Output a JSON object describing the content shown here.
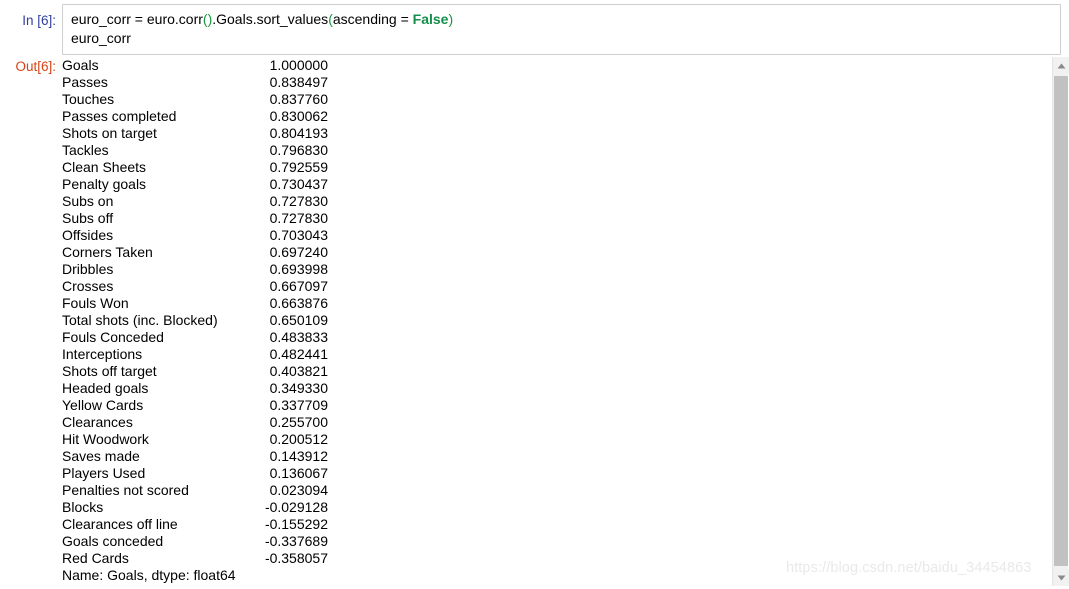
{
  "notebook": {
    "input": {
      "prompt": "In [6]:",
      "prompt_color": "#303F9F",
      "code_lines": [
        {
          "segments": [
            {
              "text": "euro_corr = euro.corr",
              "style": "plain"
            },
            {
              "text": "()",
              "style": "paren"
            },
            {
              "text": ".Goals.sort_values",
              "style": "plain"
            },
            {
              "text": "(",
              "style": "paren"
            },
            {
              "text": "ascending = ",
              "style": "plain"
            },
            {
              "text": "False",
              "style": "keyword"
            },
            {
              "text": ")",
              "style": "paren"
            }
          ],
          "plain_text": "euro_corr = euro.corr().Goals.sort_values(ascending = False)"
        },
        {
          "segments": [
            {
              "text": "euro_corr",
              "style": "plain"
            }
          ],
          "plain_text": "euro_corr"
        }
      ]
    },
    "output": {
      "prompt": "Out[6]:",
      "prompt_color": "#D84315",
      "series_name_line": "Name: Goals, dtype: float64",
      "rows": [
        {
          "label": "Goals",
          "value": "1.000000"
        },
        {
          "label": "Passes",
          "value": "0.838497"
        },
        {
          "label": "Touches",
          "value": "0.837760"
        },
        {
          "label": "Passes completed",
          "value": "0.830062"
        },
        {
          "label": "Shots on target",
          "value": "0.804193"
        },
        {
          "label": "Tackles",
          "value": "0.796830"
        },
        {
          "label": "Clean Sheets",
          "value": "0.792559"
        },
        {
          "label": "Penalty goals",
          "value": "0.730437"
        },
        {
          "label": "Subs on",
          "value": "0.727830"
        },
        {
          "label": "Subs off",
          "value": "0.727830"
        },
        {
          "label": "Offsides",
          "value": "0.703043"
        },
        {
          "label": "Corners Taken",
          "value": "0.697240"
        },
        {
          "label": "Dribbles",
          "value": "0.693998"
        },
        {
          "label": "Crosses",
          "value": "0.667097"
        },
        {
          "label": "Fouls Won",
          "value": "0.663876"
        },
        {
          "label": "Total shots (inc. Blocked)",
          "value": "0.650109"
        },
        {
          "label": "Fouls Conceded",
          "value": "0.483833"
        },
        {
          "label": "Interceptions",
          "value": "0.482441"
        },
        {
          "label": "Shots off target",
          "value": "0.403821"
        },
        {
          "label": "Headed goals",
          "value": "0.349330"
        },
        {
          "label": "Yellow Cards",
          "value": "0.337709"
        },
        {
          "label": "Clearances",
          "value": "0.255700"
        },
        {
          "label": "Hit Woodwork",
          "value": "0.200512"
        },
        {
          "label": "Saves made",
          "value": "0.143912"
        },
        {
          "label": "Players Used",
          "value": "0.136067"
        },
        {
          "label": "Penalties not scored",
          "value": "0.023094"
        },
        {
          "label": "Blocks",
          "value": "-0.029128"
        },
        {
          "label": "Clearances off line",
          "value": "-0.155292"
        },
        {
          "label": "Goals conceded",
          "value": "-0.337689"
        },
        {
          "label": "Red Cards",
          "value": "-0.358057"
        }
      ]
    },
    "scrollbar": {
      "up_arrow_icon": "triangle-up-icon",
      "down_arrow_icon": "triangle-down-icon"
    },
    "watermark": "https://blog.csdn.net/baidu_34454863"
  }
}
